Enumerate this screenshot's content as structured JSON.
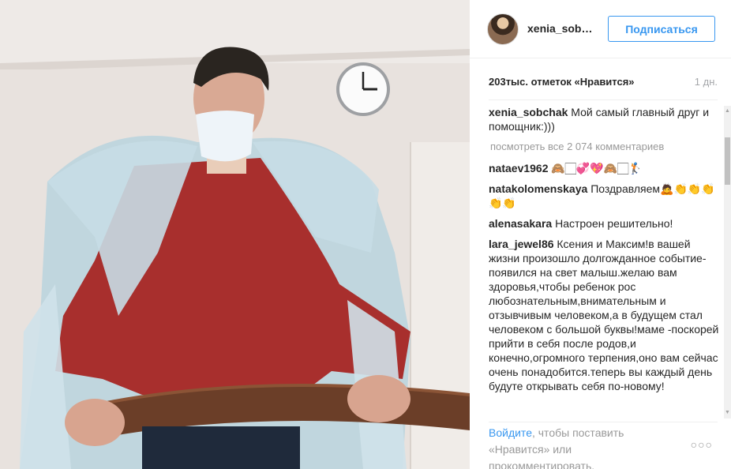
{
  "post": {
    "username": "xenia_sob…",
    "follow_label": "Подписаться",
    "likes": "203тыс. отметок «Нравится»",
    "time": "1 дн."
  },
  "comments": {
    "caption": {
      "user": "xenia_sobchak",
      "text": "Мой самый главный друг и помощник:)))"
    },
    "view_all": "посмотреть все 2 074 комментариев",
    "items": [
      {
        "user": "nataev1962",
        "text": "🙈🏻💞💖🙈🏻🏌"
      },
      {
        "user": "natakolomenskaya",
        "text": "Поздравляем🙇👏👏👏👏👏"
      },
      {
        "user": "alenasakara",
        "text": "Настроен решительно!"
      },
      {
        "user": "lara_jewel86",
        "text": "Ксения и Максим!в вашей жизни произошло долгожданное событие-появился на свет малыш.желаю вам здоровья,чтобы ребенок рос любознательным,внимательным и отзывчивым человеком,а в будущем стал человеком с большой буквы!маме -поскорей прийти в себя после родов,и конечно,огромного терпения,оно вам сейчас очень понадобится.теперь вы каждый день будуте открывать себя по-новому!"
      }
    ]
  },
  "footer": {
    "login_link": "Войдите",
    "login_rest": ", чтобы поставить «Нравится» или прокомментировать.",
    "more_icon": "more-dots-icon"
  },
  "colors": {
    "accent": "#3897f0",
    "muted": "#999999"
  }
}
